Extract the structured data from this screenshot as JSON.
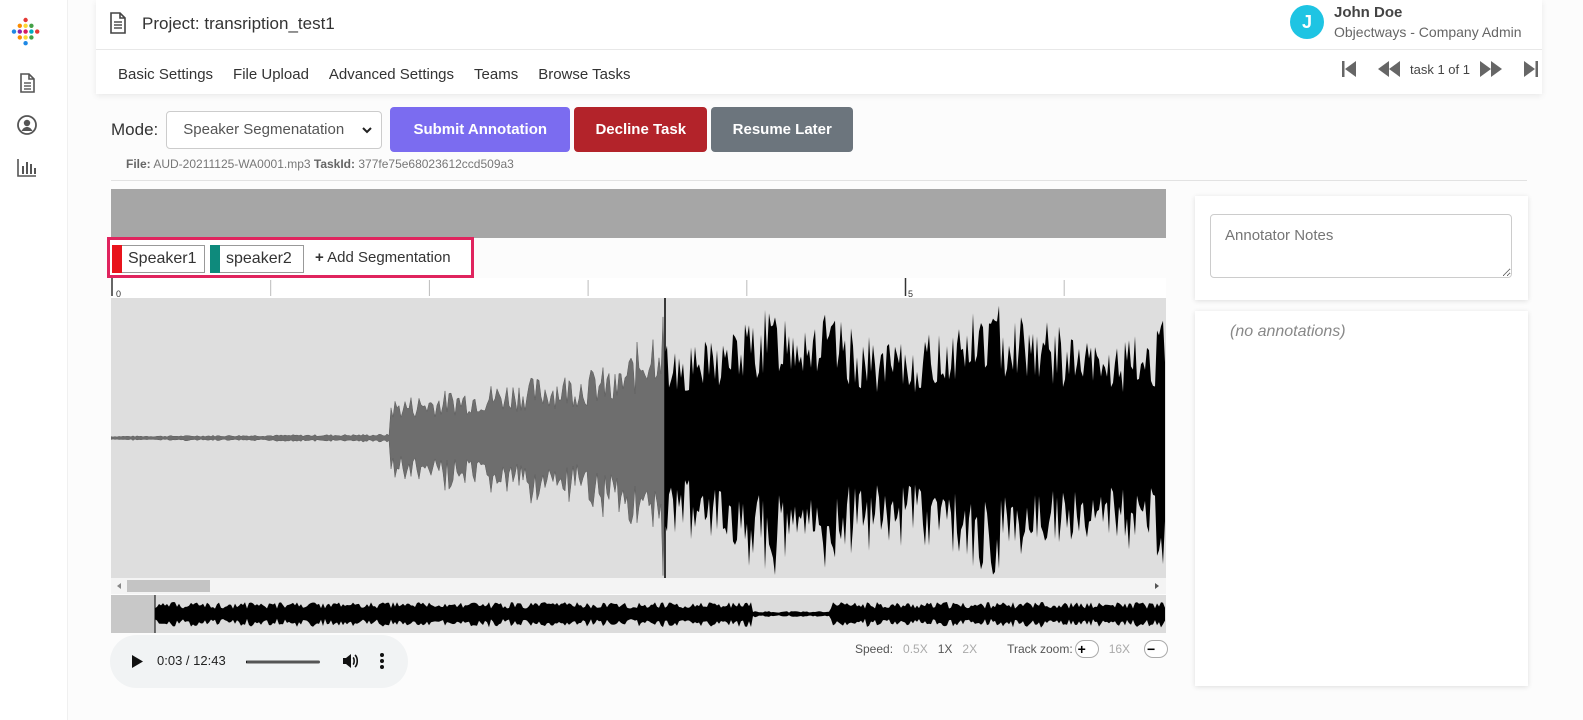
{
  "project": {
    "title": "Project: transription_test1"
  },
  "user": {
    "initial": "J",
    "name": "John Doe",
    "role": "Objectways - Company Admin"
  },
  "nav": [
    "Basic Settings",
    "File Upload",
    "Advanced Settings",
    "Teams",
    "Browse Tasks"
  ],
  "pager": {
    "label": "task 1 of 1"
  },
  "toolbar": {
    "mode_label": "Mode:",
    "mode_value": "Speaker Segmenatation",
    "submit_label": "Submit Annotation",
    "decline_label": "Decline Task",
    "resume_label": "Resume Later"
  },
  "fileinfo": {
    "file_label": "File:",
    "file_name": "AUD-20211125-WA0001.mp3",
    "task_label": "TaskId:",
    "task_id": "377fe75e68023612ccd509a3"
  },
  "segments": [
    {
      "label": "Speaker1",
      "color": "#e8141c"
    },
    {
      "label": "speaker2",
      "color": "#0e8a7c"
    }
  ],
  "add_segmentation": "Add Segmentation",
  "timeline": {
    "tick_labels": [
      "0",
      "5"
    ]
  },
  "player": {
    "time": "0:03 / 12:43",
    "progress": 0.004
  },
  "speed": {
    "label": "Speed:",
    "options": [
      "0.5X",
      "1X",
      "2X"
    ],
    "selected": "1X"
  },
  "zoom": {
    "label": "Track zoom:",
    "value": "16X"
  },
  "notes": {
    "placeholder": "Annotator Notes"
  },
  "annotations": {
    "empty_text": "(no annotations)"
  }
}
